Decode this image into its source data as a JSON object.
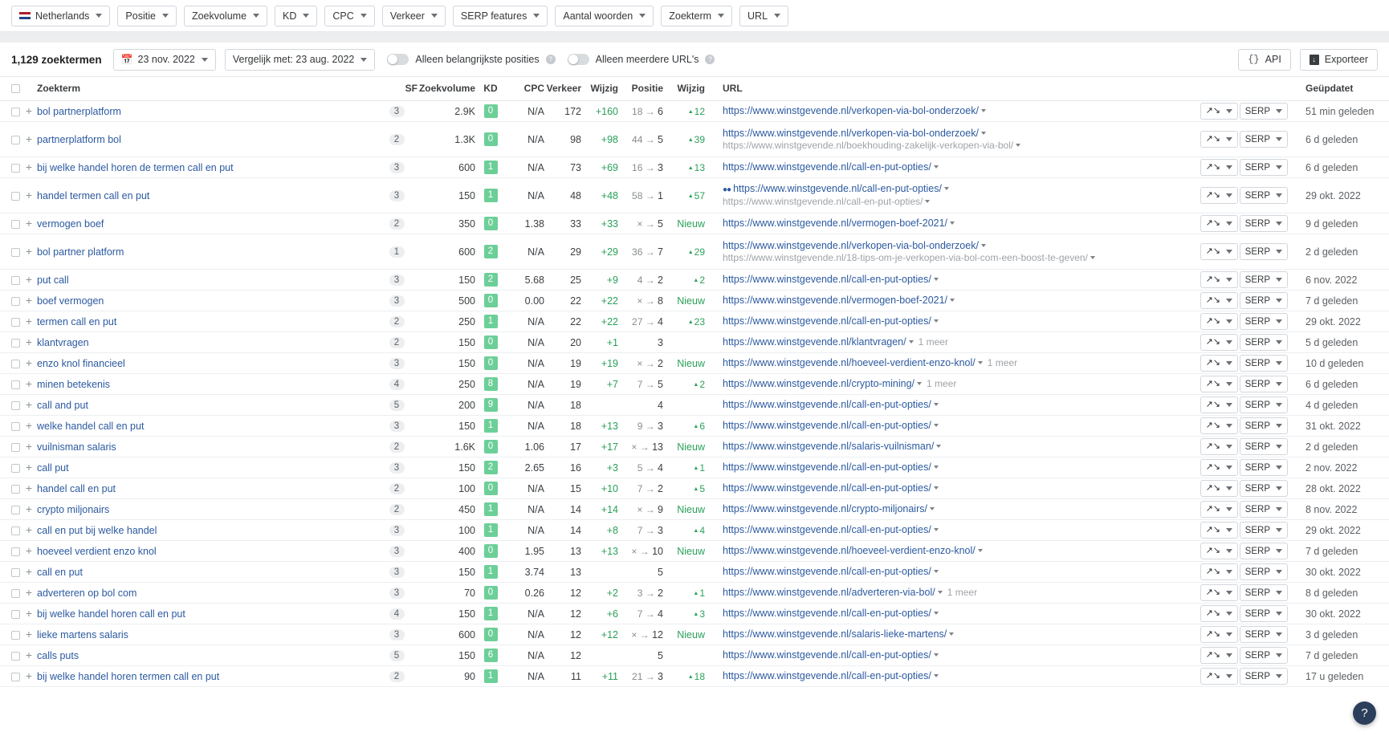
{
  "filters": [
    {
      "label": "Netherlands",
      "icon": "nl-flag-icon",
      "name": "country"
    },
    {
      "label": "Positie",
      "name": "position"
    },
    {
      "label": "Zoekvolume",
      "name": "search-volume"
    },
    {
      "label": "KD",
      "name": "kd"
    },
    {
      "label": "CPC",
      "name": "cpc"
    },
    {
      "label": "Verkeer",
      "name": "traffic"
    },
    {
      "label": "SERP features",
      "name": "serp-features"
    },
    {
      "label": "Aantal woorden",
      "name": "word-count"
    },
    {
      "label": "Zoekterm",
      "name": "keyword"
    },
    {
      "label": "URL",
      "name": "url"
    }
  ],
  "toolbar": {
    "count_label": "1,129 zoektermen",
    "date_label": "23 nov. 2022",
    "compare_label": "Vergelijk met: 23 aug. 2022",
    "toggle1_label": "Alleen belangrijkste posities",
    "toggle2_label": "Alleen meerdere URL's",
    "api_label": "API",
    "export_label": "Exporteer",
    "calendar_icon": "calendar-icon",
    "api_icon": "code-braces-icon",
    "export_icon": "export-download-icon"
  },
  "columns": {
    "keyword": "Zoekterm",
    "sf": "SF",
    "volume": "Zoekvolume",
    "kd": "KD",
    "cpc": "CPC",
    "traffic": "Verkeer",
    "change1": "Wijzig",
    "position": "Positie",
    "change2": "Wijzig",
    "url": "URL",
    "updated": "Geüpdatet"
  },
  "row_buttons": {
    "serp_label": "SERP",
    "trend_icon": "trend-chart-icon"
  },
  "help_icon": "help-question-icon",
  "accent": {
    "link": "#2c5aa0",
    "green": "#2aa05a",
    "kd_bg": "#6dcf98"
  },
  "rows": [
    {
      "keyword": "bol partnerplatform",
      "sf": "3",
      "volume": "2.9K",
      "kd": "0",
      "cpc": "N/A",
      "traffic": "172",
      "change1": "+160",
      "pos_from": "18",
      "pos_to": "6",
      "change2": "12",
      "urls": [
        {
          "text": "https://www.winstgevende.nl/verkopen-via-bol-onderzoek/",
          "sub": false
        }
      ],
      "more": "",
      "updated": "51 min geleden",
      "tall": false
    },
    {
      "keyword": "partnerplatform bol",
      "sf": "2",
      "volume": "1.3K",
      "kd": "0",
      "cpc": "N/A",
      "traffic": "98",
      "change1": "+98",
      "pos_from": "44",
      "pos_to": "5",
      "change2": "39",
      "urls": [
        {
          "text": "https://www.winstgevende.nl/verkopen-via-bol-onderzoek/",
          "sub": false
        },
        {
          "text": "https://www.winstgevende.nl/boekhouding-zakelijk-verkopen-via-bol/",
          "sub": true
        }
      ],
      "more": "",
      "updated": "6 d geleden",
      "tall": true
    },
    {
      "keyword": "bij welke handel horen de termen call en put",
      "sf": "3",
      "volume": "600",
      "kd": "1",
      "cpc": "N/A",
      "traffic": "73",
      "change1": "+69",
      "pos_from": "16",
      "pos_to": "3",
      "change2": "13",
      "urls": [
        {
          "text": "https://www.winstgevende.nl/call-en-put-opties/",
          "sub": false
        }
      ],
      "more": "",
      "updated": "6 d geleden",
      "tall": false
    },
    {
      "keyword": "handel termen call en put",
      "sf": "3",
      "volume": "150",
      "kd": "1",
      "cpc": "N/A",
      "traffic": "48",
      "change1": "+48",
      "pos_from": "58",
      "pos_to": "1",
      "change2": "57",
      "eyes": true,
      "urls": [
        {
          "text": "https://www.winstgevende.nl/call-en-put-opties/",
          "sub": false
        },
        {
          "text": "https://www.winstgevende.nl/call-en-put-opties/",
          "sub": true
        }
      ],
      "more": "",
      "updated": "29 okt. 2022",
      "tall": true
    },
    {
      "keyword": "vermogen boef",
      "sf": "2",
      "volume": "350",
      "kd": "0",
      "cpc": "1.38",
      "traffic": "33",
      "change1": "+33",
      "pos_from": "×",
      "pos_to": "5",
      "change2": "Nieuw",
      "urls": [
        {
          "text": "https://www.winstgevende.nl/vermogen-boef-2021/",
          "sub": false
        }
      ],
      "more": "",
      "updated": "9 d geleden",
      "tall": false
    },
    {
      "keyword": "bol partner platform",
      "sf": "1",
      "volume": "600",
      "kd": "2",
      "cpc": "N/A",
      "traffic": "29",
      "change1": "+29",
      "pos_from": "36",
      "pos_to": "7",
      "change2": "29",
      "urls": [
        {
          "text": "https://www.winstgevende.nl/verkopen-via-bol-onderzoek/",
          "sub": false
        },
        {
          "text": "https://www.winstgevende.nl/18-tips-om-je-verkopen-via-bol-com-een-boost-te-geven/",
          "sub": true
        }
      ],
      "more": "",
      "updated": "2 d geleden",
      "tall": true
    },
    {
      "keyword": "put call",
      "sf": "3",
      "volume": "150",
      "kd": "2",
      "cpc": "5.68",
      "traffic": "25",
      "change1": "+9",
      "pos_from": "4",
      "pos_to": "2",
      "change2": "2",
      "urls": [
        {
          "text": "https://www.winstgevende.nl/call-en-put-opties/",
          "sub": false
        }
      ],
      "more": "",
      "updated": "6 nov. 2022",
      "tall": false
    },
    {
      "keyword": "boef vermogen",
      "sf": "3",
      "volume": "500",
      "kd": "0",
      "cpc": "0.00",
      "traffic": "22",
      "change1": "+22",
      "pos_from": "×",
      "pos_to": "8",
      "change2": "Nieuw",
      "urls": [
        {
          "text": "https://www.winstgevende.nl/vermogen-boef-2021/",
          "sub": false
        }
      ],
      "more": "",
      "updated": "7 d geleden",
      "tall": false
    },
    {
      "keyword": "termen call en put",
      "sf": "2",
      "volume": "250",
      "kd": "1",
      "cpc": "N/A",
      "traffic": "22",
      "change1": "+22",
      "pos_from": "27",
      "pos_to": "4",
      "change2": "23",
      "urls": [
        {
          "text": "https://www.winstgevende.nl/call-en-put-opties/",
          "sub": false
        }
      ],
      "more": "",
      "updated": "29 okt. 2022",
      "tall": false
    },
    {
      "keyword": "klantvragen",
      "sf": "2",
      "volume": "150",
      "kd": "0",
      "cpc": "N/A",
      "traffic": "20",
      "change1": "+1",
      "pos_from": "",
      "pos_to": "3",
      "change2": "",
      "urls": [
        {
          "text": "https://www.winstgevende.nl/klantvragen/",
          "sub": false
        }
      ],
      "more": "1 meer",
      "updated": "5 d geleden",
      "tall": false
    },
    {
      "keyword": "enzo knol financieel",
      "sf": "3",
      "volume": "150",
      "kd": "0",
      "cpc": "N/A",
      "traffic": "19",
      "change1": "+19",
      "pos_from": "×",
      "pos_to": "2",
      "change2": "Nieuw",
      "urls": [
        {
          "text": "https://www.winstgevende.nl/hoeveel-verdient-enzo-knol/",
          "sub": false
        }
      ],
      "more": "1 meer",
      "updated": "10 d geleden",
      "tall": false
    },
    {
      "keyword": "minen betekenis",
      "sf": "4",
      "volume": "250",
      "kd": "8",
      "cpc": "N/A",
      "traffic": "19",
      "change1": "+7",
      "pos_from": "7",
      "pos_to": "5",
      "change2": "2",
      "urls": [
        {
          "text": "https://www.winstgevende.nl/crypto-mining/",
          "sub": false
        }
      ],
      "more": "1 meer",
      "updated": "6 d geleden",
      "tall": false
    },
    {
      "keyword": "call and put",
      "sf": "5",
      "volume": "200",
      "kd": "9",
      "cpc": "N/A",
      "traffic": "18",
      "change1": "",
      "pos_from": "",
      "pos_to": "4",
      "change2": "",
      "urls": [
        {
          "text": "https://www.winstgevende.nl/call-en-put-opties/",
          "sub": false
        }
      ],
      "more": "",
      "updated": "4 d geleden",
      "tall": false
    },
    {
      "keyword": "welke handel call en put",
      "sf": "3",
      "volume": "150",
      "kd": "1",
      "cpc": "N/A",
      "traffic": "18",
      "change1": "+13",
      "pos_from": "9",
      "pos_to": "3",
      "change2": "6",
      "urls": [
        {
          "text": "https://www.winstgevende.nl/call-en-put-opties/",
          "sub": false
        }
      ],
      "more": "",
      "updated": "31 okt. 2022",
      "tall": false
    },
    {
      "keyword": "vuilnisman salaris",
      "sf": "2",
      "volume": "1.6K",
      "kd": "0",
      "cpc": "1.06",
      "traffic": "17",
      "change1": "+17",
      "pos_from": "×",
      "pos_to": "13",
      "change2": "Nieuw",
      "urls": [
        {
          "text": "https://www.winstgevende.nl/salaris-vuilnisman/",
          "sub": false
        }
      ],
      "more": "",
      "updated": "2 d geleden",
      "tall": false
    },
    {
      "keyword": "call put",
      "sf": "3",
      "volume": "150",
      "kd": "2",
      "cpc": "2.65",
      "traffic": "16",
      "change1": "+3",
      "pos_from": "5",
      "pos_to": "4",
      "change2": "1",
      "urls": [
        {
          "text": "https://www.winstgevende.nl/call-en-put-opties/",
          "sub": false
        }
      ],
      "more": "",
      "updated": "2 nov. 2022",
      "tall": false
    },
    {
      "keyword": "handel call en put",
      "sf": "2",
      "volume": "100",
      "kd": "0",
      "cpc": "N/A",
      "traffic": "15",
      "change1": "+10",
      "pos_from": "7",
      "pos_to": "2",
      "change2": "5",
      "urls": [
        {
          "text": "https://www.winstgevende.nl/call-en-put-opties/",
          "sub": false
        }
      ],
      "more": "",
      "updated": "28 okt. 2022",
      "tall": false
    },
    {
      "keyword": "crypto miljonairs",
      "sf": "2",
      "volume": "450",
      "kd": "1",
      "cpc": "N/A",
      "traffic": "14",
      "change1": "+14",
      "pos_from": "×",
      "pos_to": "9",
      "change2": "Nieuw",
      "urls": [
        {
          "text": "https://www.winstgevende.nl/crypto-miljonairs/",
          "sub": false
        }
      ],
      "more": "",
      "updated": "8 nov. 2022",
      "tall": false
    },
    {
      "keyword": "call en put bij welke handel",
      "sf": "3",
      "volume": "100",
      "kd": "1",
      "cpc": "N/A",
      "traffic": "14",
      "change1": "+8",
      "pos_from": "7",
      "pos_to": "3",
      "change2": "4",
      "urls": [
        {
          "text": "https://www.winstgevende.nl/call-en-put-opties/",
          "sub": false
        }
      ],
      "more": "",
      "updated": "29 okt. 2022",
      "tall": false
    },
    {
      "keyword": "hoeveel verdient enzo knol",
      "sf": "3",
      "volume": "400",
      "kd": "0",
      "cpc": "1.95",
      "traffic": "13",
      "change1": "+13",
      "pos_from": "×",
      "pos_to": "10",
      "change2": "Nieuw",
      "urls": [
        {
          "text": "https://www.winstgevende.nl/hoeveel-verdient-enzo-knol/",
          "sub": false
        }
      ],
      "more": "",
      "updated": "7 d geleden",
      "tall": false
    },
    {
      "keyword": "call en put",
      "sf": "3",
      "volume": "150",
      "kd": "1",
      "cpc": "3.74",
      "traffic": "13",
      "change1": "",
      "pos_from": "",
      "pos_to": "5",
      "change2": "",
      "urls": [
        {
          "text": "https://www.winstgevende.nl/call-en-put-opties/",
          "sub": false
        }
      ],
      "more": "",
      "updated": "30 okt. 2022",
      "tall": false
    },
    {
      "keyword": "adverteren op bol com",
      "sf": "3",
      "volume": "70",
      "kd": "0",
      "cpc": "0.26",
      "traffic": "12",
      "change1": "+2",
      "pos_from": "3",
      "pos_to": "2",
      "change2": "1",
      "urls": [
        {
          "text": "https://www.winstgevende.nl/adverteren-via-bol/",
          "sub": false
        }
      ],
      "more": "1 meer",
      "updated": "8 d geleden",
      "tall": false
    },
    {
      "keyword": "bij welke handel horen call en put",
      "sf": "4",
      "volume": "150",
      "kd": "1",
      "cpc": "N/A",
      "traffic": "12",
      "change1": "+6",
      "pos_from": "7",
      "pos_to": "4",
      "change2": "3",
      "urls": [
        {
          "text": "https://www.winstgevende.nl/call-en-put-opties/",
          "sub": false
        }
      ],
      "more": "",
      "updated": "30 okt. 2022",
      "tall": false
    },
    {
      "keyword": "lieke martens salaris",
      "sf": "3",
      "volume": "600",
      "kd": "0",
      "cpc": "N/A",
      "traffic": "12",
      "change1": "+12",
      "pos_from": "×",
      "pos_to": "12",
      "change2": "Nieuw",
      "urls": [
        {
          "text": "https://www.winstgevende.nl/salaris-lieke-martens/",
          "sub": false
        }
      ],
      "more": "",
      "updated": "3 d geleden",
      "tall": false
    },
    {
      "keyword": "calls puts",
      "sf": "5",
      "volume": "150",
      "kd": "6",
      "cpc": "N/A",
      "traffic": "12",
      "change1": "",
      "pos_from": "",
      "pos_to": "5",
      "change2": "",
      "urls": [
        {
          "text": "https://www.winstgevende.nl/call-en-put-opties/",
          "sub": false
        }
      ],
      "more": "",
      "updated": "7 d geleden",
      "tall": false
    },
    {
      "keyword": "bij welke handel horen termen call en put",
      "sf": "2",
      "volume": "90",
      "kd": "1",
      "cpc": "N/A",
      "traffic": "11",
      "change1": "+11",
      "pos_from": "21",
      "pos_to": "3",
      "change2": "18",
      "urls": [
        {
          "text": "https://www.winstgevende.nl/call-en-put-opties/",
          "sub": false
        }
      ],
      "more": "",
      "updated": "17 u geleden",
      "tall": false
    }
  ]
}
